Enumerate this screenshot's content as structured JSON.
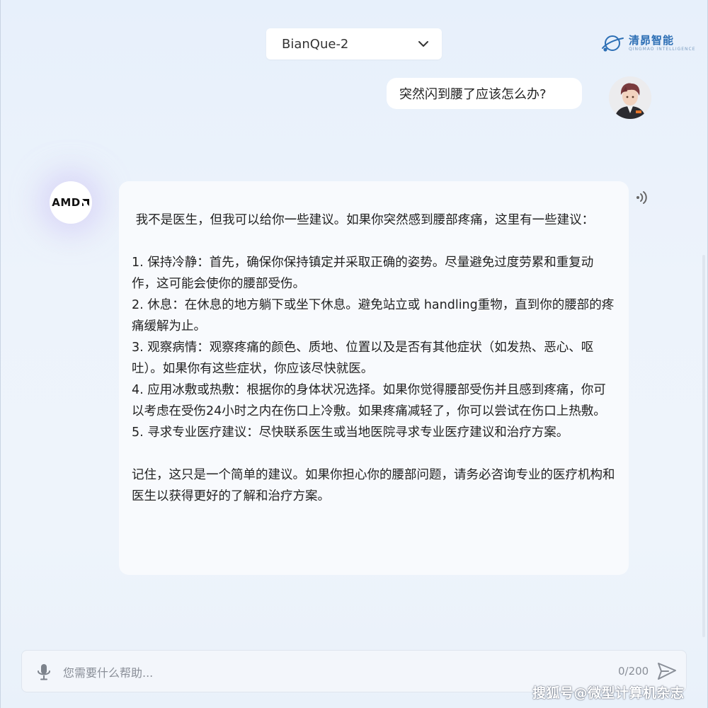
{
  "header": {
    "model_selector": {
      "value": "BianQue-2",
      "icon": "chevron-down-icon"
    },
    "brand": {
      "name_cn": "清昴智能",
      "name_en": "QINGMAO INTELLIGENCE"
    }
  },
  "conversation": {
    "user_message": "突然闪到腰了应该怎么办?",
    "bot": {
      "avatar_label": "AMD",
      "paragraphs": [
        " 我不是医生，但我可以给你一些建议。如果你突然感到腰部疼痛，这里有一些建议：",
        "",
        "1. 保持冷静：首先，确保你保持镇定并采取正确的姿势。尽量避免过度劳累和重复动作，这可能会使你的腰部受伤。",
        "2. 休息：在休息的地方躺下或坐下休息。避免站立或 handling重物，直到你的腰部的疼痛缓解为止。",
        "3. 观察病情：观察疼痛的颜色、质地、位置以及是否有其他症状（如发热、恶心、呕吐）。如果你有这些症状，你应该尽快就医。",
        "4. 应用冰敷或热敷：根据你的身体状况选择。如果你觉得腰部受伤并且感到疼痛，你可以考虑在受伤24小时之内在伤口上冷敷。如果疼痛减轻了，你可以尝试在伤口上热敷。",
        "5. 寻求专业医疗建议：尽快联系医生或当地医院寻求专业医疗建议和治疗方案。",
        "",
        "记住，这只是一个简单的建议。如果你担心你的腰部问题，请务必咨询专业的医疗机构和医生以获得更好的了解和治疗方案。"
      ]
    }
  },
  "input": {
    "placeholder": "您需要什么帮助...",
    "value": "",
    "counter": "0/200"
  },
  "watermark": "搜狐号@微型计算机杂志",
  "colors": {
    "brand_blue": "#2d6fb5",
    "background": "#eaf2fb"
  }
}
